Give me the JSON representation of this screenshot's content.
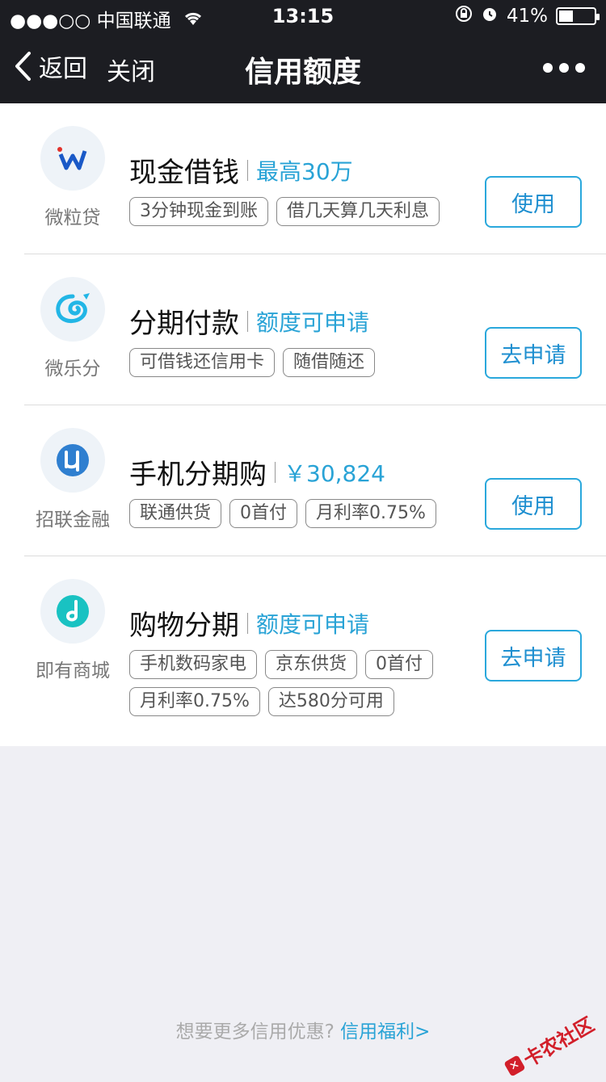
{
  "status": {
    "carrier": "●●●○○ 中国联通",
    "time": "13:15",
    "battery": "41%",
    "battery_level": 0.41
  },
  "nav": {
    "back_label": "返回",
    "close_label": "关闭",
    "title": "信用额度"
  },
  "items": [
    {
      "logo_label": "微粒贷",
      "title": "现金借钱",
      "subtitle": "最高30万",
      "tags": [
        "3分钟现金到账",
        "借几天算几天利息"
      ],
      "action": "使用"
    },
    {
      "logo_label": "微乐分",
      "title": "分期付款",
      "subtitle": "额度可申请",
      "tags": [
        "可借钱还信用卡",
        "随借随还"
      ],
      "action": "去申请"
    },
    {
      "logo_label": "招联金融",
      "title": "手机分期购",
      "subtitle": "￥30,824",
      "tags": [
        "联通供货",
        "0首付",
        "月利率0.75%"
      ],
      "action": "使用"
    },
    {
      "logo_label": "即有商城",
      "title": "购物分期",
      "subtitle": "额度可申请",
      "tags": [
        "手机数码家电",
        "京东供货",
        "0首付",
        "月利率0.75%",
        "达580分可用"
      ],
      "action": "去申请"
    }
  ],
  "footer": {
    "prompt": "想要更多信用优惠?",
    "link": "信用福利>"
  },
  "watermark": "卡农社区",
  "colors": {
    "accent": "#29a3d6",
    "nav_bg": "#1c1d22",
    "page_bg": "#efeff4"
  }
}
